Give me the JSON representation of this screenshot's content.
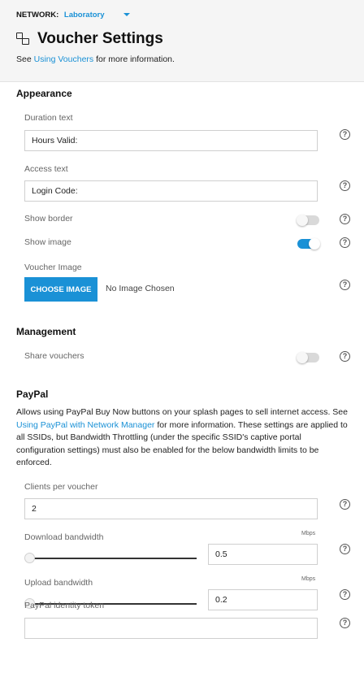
{
  "header": {
    "network_label": "NETWORK:",
    "network_name": "Laboratory",
    "page_title": "Voucher Settings",
    "subtitle_prefix": "See ",
    "subtitle_link": "Using Vouchers",
    "subtitle_suffix": " for more information."
  },
  "appearance": {
    "title": "Appearance",
    "duration_label": "Duration text",
    "duration_value": "Hours Valid:",
    "access_label": "Access text",
    "access_value": "Login Code:",
    "show_border_label": "Show border",
    "show_border_on": false,
    "show_image_label": "Show image",
    "show_image_on": true,
    "voucher_image_label": "Voucher Image",
    "choose_image_button": "CHOOSE IMAGE",
    "no_image_text": "No Image Chosen"
  },
  "management": {
    "title": "Management",
    "share_label": "Share vouchers",
    "share_on": false
  },
  "paypal": {
    "title": "PayPal",
    "desc_1": "Allows using PayPal Buy Now buttons on your splash pages to sell internet access. See ",
    "desc_link": "Using PayPal with Network Manager",
    "desc_2": " for more information. These settings are applied to all SSIDs, but Bandwidth Throttling (under the specific SSID's captive portal configuration settings) must also be enabled for the below bandwidth limits to be enforced.",
    "clients_label": "Clients per voucher",
    "clients_value": "2",
    "download_label": "Download bandwidth",
    "download_unit": "Mbps",
    "download_value": "0.5",
    "upload_label": "Upload bandwidth",
    "upload_unit": "Mbps",
    "upload_value": "0.2",
    "token_label": "PayPal identity token",
    "token_value": ""
  },
  "help_glyph": "?",
  "colors": {
    "accent": "#1a91d6",
    "header_bg": "#f5f5f5"
  }
}
